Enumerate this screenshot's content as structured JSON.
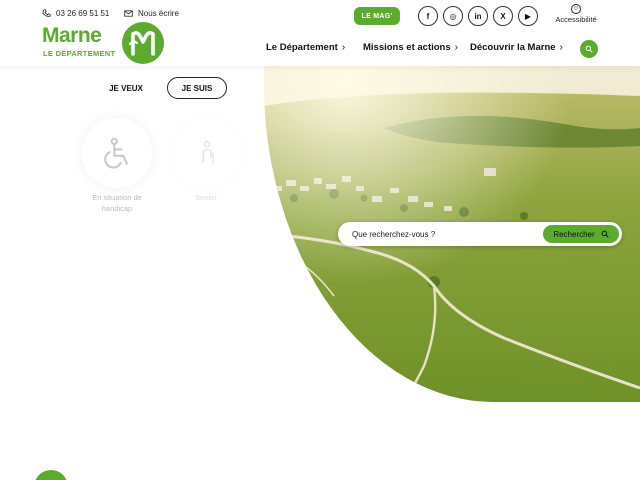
{
  "header": {
    "phone": "03 26 69 51 51",
    "mail_label": "Nous écrire",
    "logo_word": "Marne",
    "logo_sub": "LE DÉPARTEMENT",
    "mag_label": "LE MAG'",
    "socials": [
      "f",
      "◎",
      "in",
      "X",
      "▶"
    ],
    "accessibility_label": "Accessibilité"
  },
  "nav": {
    "items": [
      {
        "label": "Le Département"
      },
      {
        "label": "Missions et actions"
      },
      {
        "label": "Découvrir la Marne"
      }
    ]
  },
  "profile": {
    "tab_veux": "JE VEUX",
    "tab_suis": "JE SUIS",
    "cards": [
      {
        "label": "En situation de handicap",
        "icon": "wheelchair-icon"
      },
      {
        "label": "Senior",
        "icon": "senior-icon"
      }
    ]
  },
  "search": {
    "placeholder": "Que recherchez-vous ?",
    "button_label": "Rechercher"
  },
  "colors": {
    "brand_green": "#5bab2f"
  }
}
